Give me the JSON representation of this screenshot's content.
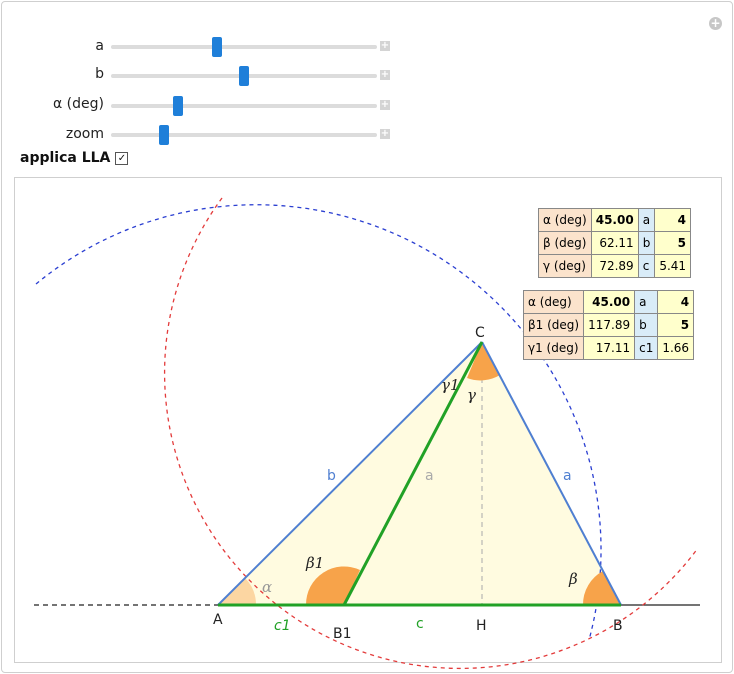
{
  "controls": {
    "sliders": [
      {
        "label": "a",
        "fraction": 0.4
      },
      {
        "label": "b",
        "fraction": 0.5
      },
      {
        "label": "α (deg)",
        "fraction": 0.25
      },
      {
        "label": "zoom",
        "fraction": 0.2
      }
    ],
    "checkbox": {
      "label": "applica LLA",
      "checked": true
    }
  },
  "table1": {
    "rows": [
      {
        "angle": "α (deg)",
        "angle_value": "45.00",
        "angle_bold": true,
        "side": "a",
        "side_value": "4",
        "side_bold": true
      },
      {
        "angle": "β (deg)",
        "angle_value": "62.11",
        "angle_bold": false,
        "side": "b",
        "side_value": "5",
        "side_bold": true
      },
      {
        "angle": "γ (deg)",
        "angle_value": "72.89",
        "angle_bold": false,
        "side": "c",
        "side_value": "5.41",
        "side_bold": false
      }
    ]
  },
  "table2": {
    "rows": [
      {
        "angle": "α (deg)",
        "angle_value": "45.00",
        "angle_bold": true,
        "side": "a",
        "side_value": "4",
        "side_bold": true
      },
      {
        "angle": "β1 (deg)",
        "angle_value": "117.89",
        "angle_bold": false,
        "side": "b",
        "side_value": "5",
        "side_bold": true
      },
      {
        "angle": "γ1 (deg)",
        "angle_value": "17.11",
        "angle_bold": false,
        "side": "c1",
        "side_value": "1.66",
        "side_bold": false
      }
    ]
  },
  "diagram": {
    "points": {
      "A": "A",
      "B": "B",
      "C": "C",
      "H": "H",
      "B1": "B1"
    },
    "sides": {
      "a": "a",
      "b": "b",
      "c": "c",
      "c1": "c1"
    },
    "angles": {
      "alpha": "α",
      "beta": "β",
      "gamma": "γ",
      "beta1": "β1",
      "gamma1": "γ1"
    },
    "colors": {
      "triangle_fill": "#fffbe0",
      "blue_side": "#4f7fd1",
      "green_side": "#21a126",
      "red_circle": "#e33b3b",
      "blue_circle": "#2b3fd1",
      "angle_orange": "#f7a34a",
      "angle_light": "#fcd6a2"
    }
  }
}
